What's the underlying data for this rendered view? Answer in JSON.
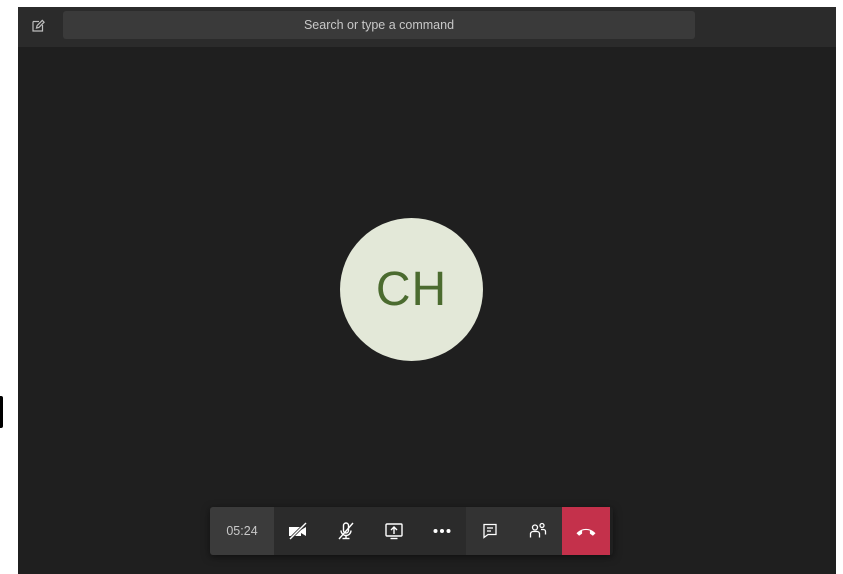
{
  "search": {
    "placeholder": "Search or type a command"
  },
  "call": {
    "avatar_initials": "CH",
    "timer": "05:24"
  },
  "colors": {
    "background": "#1f1f1f",
    "titlebar": "#2b2b2b",
    "avatar_bg": "#e3e8d8",
    "avatar_text": "#4b6b2f",
    "hangup": "#c4314b"
  },
  "icons": {
    "compose": "compose-icon",
    "camera": "camera-off-icon",
    "mic": "mic-off-icon",
    "share": "share-screen-icon",
    "more": "more-icon",
    "chat": "chat-icon",
    "participants": "participants-icon",
    "hangup": "hangup-icon"
  }
}
